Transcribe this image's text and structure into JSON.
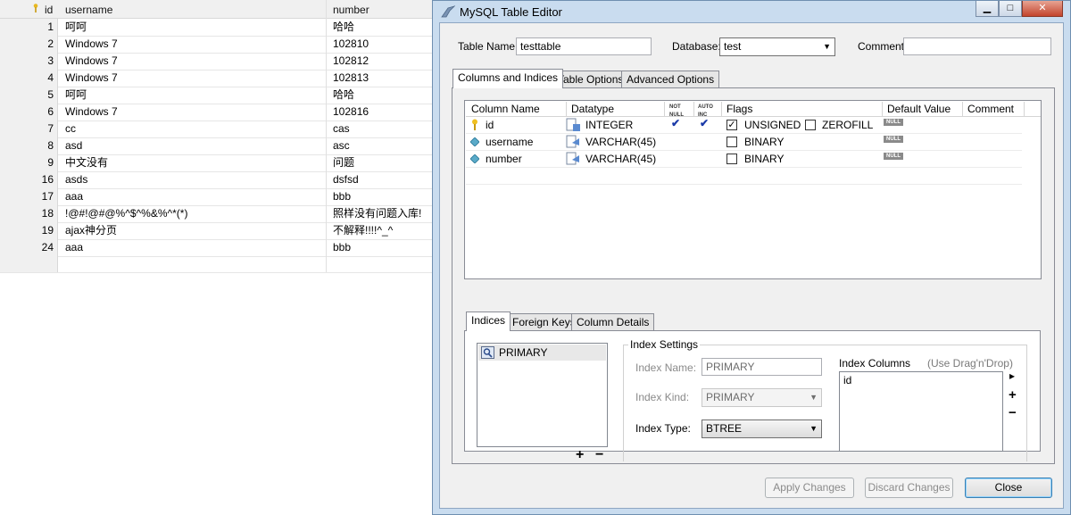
{
  "grid": {
    "headers": {
      "id": "id",
      "username": "username",
      "number": "number"
    },
    "rows": [
      {
        "id": "1",
        "username": "呵呵",
        "number": "哈哈"
      },
      {
        "id": "2",
        "username": "Windows 7",
        "number": "102810"
      },
      {
        "id": "3",
        "username": "Windows 7",
        "number": "102812"
      },
      {
        "id": "4",
        "username": "Windows 7",
        "number": "102813"
      },
      {
        "id": "5",
        "username": "呵呵",
        "number": "哈哈"
      },
      {
        "id": "6",
        "username": "Windows 7",
        "number": "102816"
      },
      {
        "id": "7",
        "username": "cc",
        "number": "cas"
      },
      {
        "id": "8",
        "username": "asd",
        "number": "asc"
      },
      {
        "id": "9",
        "username": "中文没有",
        "number": "问题"
      },
      {
        "id": "16",
        "username": "asds",
        "number": "dsfsd"
      },
      {
        "id": "17",
        "username": "aaa",
        "number": "bbb"
      },
      {
        "id": "18",
        "username": "!@#!@#@%^$^%&%^*(*)",
        "number": "照样没有问题入库!"
      },
      {
        "id": "19",
        "username": "ajax神分页",
        "number": "不解释!!!!^_^"
      },
      {
        "id": "24",
        "username": "aaa",
        "number": "bbb"
      }
    ]
  },
  "window": {
    "title": "MySQL Table Editor",
    "min_glyph": "▁",
    "max_glyph": "□",
    "close_glyph": "✕"
  },
  "form": {
    "table_name_label": "Table Name:",
    "table_name_value": "testtable",
    "database_label": "Database:",
    "database_value": "test",
    "comment_label": "Comment:",
    "comment_value": ""
  },
  "tabs": {
    "columns_indices": "Columns and Indices",
    "table_options": "Table Options",
    "advanced_options": "Advanced Options"
  },
  "columns_table": {
    "headers": {
      "column_name": "Column Name",
      "datatype": "Datatype",
      "not_null_1": "NOT",
      "not_null_2": "NULL",
      "auto_inc_1": "AUTO",
      "auto_inc_2": "INC",
      "flags": "Flags",
      "default_value": "Default Value",
      "comment": "Comment"
    },
    "rows": [
      {
        "name": "id",
        "type": "INTEGER",
        "not_null": true,
        "auto_inc": true,
        "flag1": "UNSIGNED",
        "flag1_checked": true,
        "flag2": "ZEROFILL",
        "flag2_checked": false,
        "default": "NULL",
        "icon": "primary-key-icon"
      },
      {
        "name": "username",
        "type": "VARCHAR(45)",
        "not_null": false,
        "auto_inc": false,
        "flag1": "BINARY",
        "flag1_checked": false,
        "default": "NULL",
        "icon": "column-diamond-icon"
      },
      {
        "name": "number",
        "type": "VARCHAR(45)",
        "not_null": false,
        "auto_inc": false,
        "flag1": "BINARY",
        "flag1_checked": false,
        "default": "NULL",
        "icon": "column-diamond-icon"
      }
    ]
  },
  "lower_tabs": {
    "indices": "Indices",
    "foreign_keys": "Foreign Keys",
    "column_details": "Column Details"
  },
  "indices": {
    "list": [
      "PRIMARY"
    ],
    "add_glyph": "+",
    "remove_glyph": "−",
    "settings_title": "Index Settings",
    "name_label": "Index Name:",
    "name_value": "PRIMARY",
    "kind_label": "Index Kind:",
    "kind_value": "PRIMARY",
    "type_label": "Index Type:",
    "type_value": "BTREE",
    "columns_label": "Index Columns",
    "columns_hint": "(Use Drag'n'Drop)",
    "columns": [
      "id"
    ],
    "side_glyphs": [
      "▸",
      "+",
      "−"
    ]
  },
  "buttons": {
    "apply": "Apply Changes",
    "discard": "Discard Changes",
    "close": "Close"
  }
}
